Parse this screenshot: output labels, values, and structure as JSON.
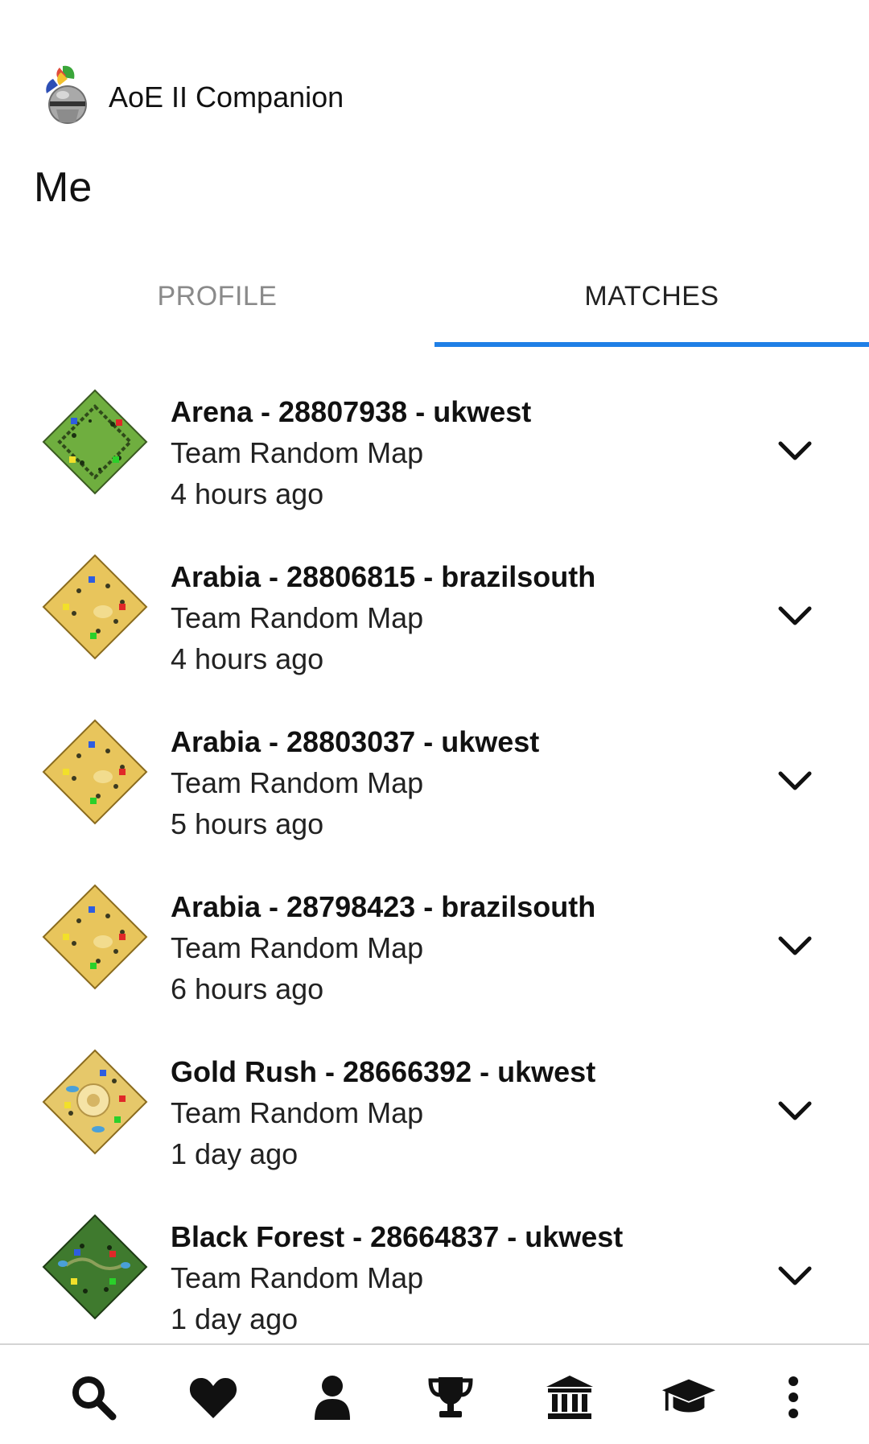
{
  "app": {
    "title": "AoE II Companion"
  },
  "page": {
    "title": "Me"
  },
  "tabs": [
    {
      "label": "PROFILE",
      "active": false
    },
    {
      "label": "MATCHES",
      "active": true
    }
  ],
  "colors": {
    "accent": "#1f7fe6",
    "inactive_tab": "#8a8a8a",
    "text": "#111111"
  },
  "matches": [
    {
      "title": "Arena - 28807938 - ukwest",
      "type": "Team Random Map",
      "time": "4 hours ago",
      "map": "arena"
    },
    {
      "title": "Arabia - 28806815 - brazilsouth",
      "type": "Team Random Map",
      "time": "4 hours ago",
      "map": "arabia"
    },
    {
      "title": "Arabia - 28803037 - ukwest",
      "type": "Team Random Map",
      "time": "5 hours ago",
      "map": "arabia"
    },
    {
      "title": "Arabia - 28798423 - brazilsouth",
      "type": "Team Random Map",
      "time": "6 hours ago",
      "map": "arabia"
    },
    {
      "title": "Gold Rush - 28666392 - ukwest",
      "type": "Team Random Map",
      "time": "1 day ago",
      "map": "gold-rush"
    },
    {
      "title": "Black Forest - 28664837 - ukwest",
      "type": "Team Random Map",
      "time": "1 day ago",
      "map": "black-forest"
    }
  ],
  "bottom_nav": [
    {
      "icon": "search-icon"
    },
    {
      "icon": "heart-icon"
    },
    {
      "icon": "user-icon"
    },
    {
      "icon": "trophy-icon"
    },
    {
      "icon": "bank-icon"
    },
    {
      "icon": "graduation-cap-icon"
    },
    {
      "icon": "more-vertical-icon"
    }
  ]
}
